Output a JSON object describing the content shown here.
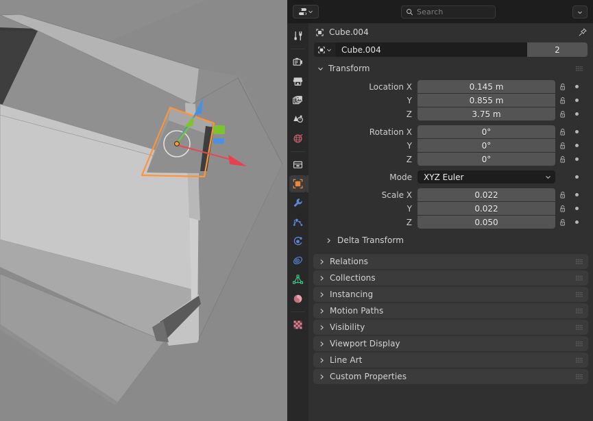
{
  "app": "blender-properties-editor",
  "viewport": {
    "name": "3d-viewport",
    "background_color": "#8a8a8a",
    "selected_outline_color": "#ff9335",
    "gizmo": {
      "type": "move-gizmo",
      "x_axis_color": "#e34a52",
      "y_axis_color": "#7dc42c",
      "z_axis_color": "#4a8fe0",
      "origin_dot_color": "#f0a030",
      "view_circle_color": "#e8e8e8"
    }
  },
  "header": {
    "editor_type_icon": "properties-editor-icon",
    "editor_type_chevron": "chevron-down-icon",
    "search": {
      "icon": "search-icon",
      "placeholder": "Search",
      "value": ""
    },
    "options_chevron": "chevron-down-icon"
  },
  "tabs": [
    {
      "id": "tool",
      "icon": "tool-icon",
      "color": "#cfcfcf",
      "active": false
    },
    {
      "id": "render",
      "icon": "render-camera-icon",
      "color": "#cfcfcf",
      "active": false
    },
    {
      "id": "output",
      "icon": "output-printer-icon",
      "color": "#cfcfcf",
      "active": false
    },
    {
      "id": "view-layer",
      "icon": "view-layer-images-icon",
      "color": "#cfcfcf",
      "active": false
    },
    {
      "id": "scene",
      "icon": "scene-cone-icon",
      "color": "#cfcfcf",
      "active": false
    },
    {
      "id": "world",
      "icon": "world-globe-icon",
      "color": "#c0616b",
      "active": false
    },
    {
      "id": "collection",
      "icon": "collection-box-icon",
      "color": "#cfcfcf",
      "active": false
    },
    {
      "id": "object",
      "icon": "object-square-icon",
      "color": "#e8893c",
      "active": true
    },
    {
      "id": "modifiers",
      "icon": "modifier-wrench-icon",
      "color": "#5a87d8",
      "active": false
    },
    {
      "id": "particles",
      "icon": "particles-icon",
      "color": "#5a87d8",
      "active": false
    },
    {
      "id": "physics",
      "icon": "physics-orbit-icon",
      "color": "#5a87d8",
      "active": false
    },
    {
      "id": "constraints",
      "icon": "constraints-icon",
      "color": "#5a87d8",
      "active": false
    },
    {
      "id": "object-data",
      "icon": "mesh-data-triangle-icon",
      "color": "#3ec78a",
      "active": false
    },
    {
      "id": "material",
      "icon": "material-sphere-icon",
      "color": "#c4737d",
      "active": false
    },
    {
      "id": "texture",
      "icon": "texture-checker-icon",
      "color": "#c4737d",
      "active": false
    }
  ],
  "breadcrumb": {
    "icon": "object-icon",
    "label": "Cube.004",
    "pin_icon": "pin-icon"
  },
  "id_block": {
    "browse_icon": "object-icon",
    "browse_chevron": "chevron-down-icon",
    "name": "Cube.004",
    "users": "2"
  },
  "transform": {
    "title": "Transform",
    "expanded": true,
    "grip_icon": "panel-grip-icon",
    "location": {
      "label_x": "Location X",
      "label_y": "Y",
      "label_z": "Z",
      "x": "0.145 m",
      "y": "0.855 m",
      "z": "3.75 m"
    },
    "rotation": {
      "label_x": "Rotation X",
      "label_y": "Y",
      "label_z": "Z",
      "x": "0°",
      "y": "0°",
      "z": "0°"
    },
    "mode": {
      "label": "Mode",
      "value": "XYZ Euler"
    },
    "scale": {
      "label_x": "Scale X",
      "label_y": "Y",
      "label_z": "Z",
      "x": "0.022",
      "y": "0.022",
      "z": "0.050"
    },
    "lock_icon": "unlocked-padlock-icon",
    "decorator_icon": "animate-property-dot-icon"
  },
  "sub_panels": [
    {
      "id": "delta-transform",
      "label": "Delta Transform",
      "expanded": false,
      "nested": true,
      "grip": false
    }
  ],
  "panels": [
    {
      "id": "relations",
      "label": "Relations",
      "expanded": false
    },
    {
      "id": "collections",
      "label": "Collections",
      "expanded": false
    },
    {
      "id": "instancing",
      "label": "Instancing",
      "expanded": false
    },
    {
      "id": "motion-paths",
      "label": "Motion Paths",
      "expanded": false
    },
    {
      "id": "visibility",
      "label": "Visibility",
      "expanded": false
    },
    {
      "id": "viewport-display",
      "label": "Viewport Display",
      "expanded": false
    },
    {
      "id": "line-art",
      "label": "Line Art",
      "expanded": false
    },
    {
      "id": "custom-properties",
      "label": "Custom Properties",
      "expanded": false
    }
  ],
  "colors": {
    "editor_bg": "#303030",
    "header_bg": "#1d1d1d",
    "tab_rail_bg": "#282828",
    "panel_header_bg": "#3b3b3b",
    "field_bg": "#545454",
    "dropdown_bg": "#1d1d1d",
    "text": "#d4d4d4"
  }
}
